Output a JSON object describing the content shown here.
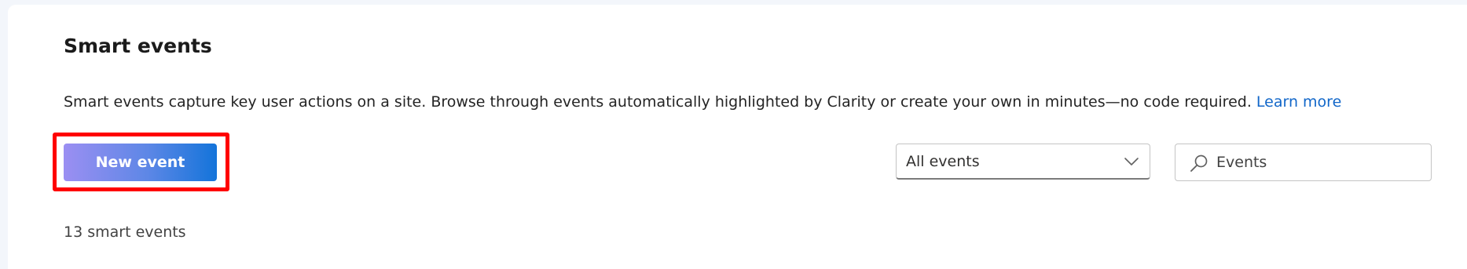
{
  "header": {
    "title": "Smart events"
  },
  "description": {
    "text": "Smart events capture key user actions on a site. Browse through events automatically highlighted by Clarity or create your own in minutes—no code required. ",
    "link_label": "Learn more"
  },
  "toolbar": {
    "new_event_label": "New event",
    "filter_selected": "All events",
    "search_placeholder": "Events",
    "search_value": ""
  },
  "summary": {
    "count_text": "13 smart events"
  },
  "icons": {
    "chevron": "chevron-down-icon",
    "search": "search-icon"
  },
  "colors": {
    "link": "#1267c9",
    "button_gradient_start": "#9b8ff2",
    "button_gradient_end": "#1374da",
    "highlight_border": "#ff0000"
  }
}
